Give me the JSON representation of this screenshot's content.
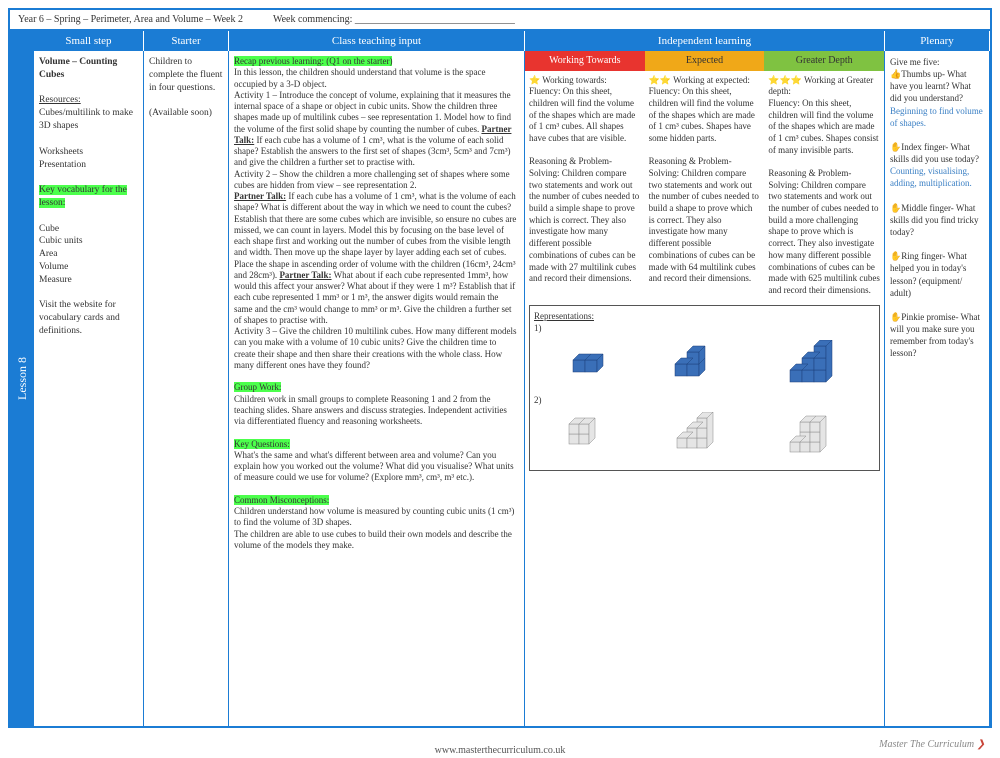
{
  "header": {
    "title": "Year 6 – Spring – Perimeter, Area and Volume – Week 2",
    "week": "Week commencing: ________________________________"
  },
  "lesson_tab": "Lesson 8",
  "col_headers": {
    "c1": "Small step",
    "c2": "Starter",
    "c3": "Class teaching input",
    "c4": "Independent learning",
    "c5": "Plenary"
  },
  "small_step": {
    "title": "Volume – Counting Cubes",
    "res_h": "Resources:",
    "res": "Cubes/multilink to make 3D shapes",
    "ws": "Worksheets",
    "pres": "Presentation",
    "kv_h": "Key vocabulary for the lesson:",
    "kv1": "Cube",
    "kv2": "Cubic units",
    "kv3": "Area",
    "kv4": "Volume",
    "kv5": "Measure",
    "visit": "Visit the website for vocabulary cards and definitions."
  },
  "starter": {
    "t1": "Children to complete the fluent in four questions.",
    "t2": "(Available soon)"
  },
  "teaching": {
    "recap": "Recap previous learning: (Q1 on the starter)",
    "intro": "In this lesson, the children should understand that volume is the space occupied by a 3-D object.",
    "a1": "Activity 1 – Introduce the concept of volume, explaining that it measures the internal space of a shape or object in cubic units. Show the children three shapes made up of multilink cubes – see representation 1. Model how to find the volume of the first solid shape by counting the number of cubes. ",
    "pt1_h": "Partner Talk:",
    "pt1": " If each cube has a volume of 1 cm³, what is the volume of each solid shape? Establish the answers to the first set of shapes (3cm³, 5cm³ and 7cm³) and give the children a further set to practise with.",
    "a2": "Activity 2 – Show the children a more challenging set of shapes where some cubes are hidden from view – see representation 2.",
    "pt2_h": "Partner Talk:",
    "pt2": " If each cube has a volume of 1 cm³, what is the volume of each shape? What is different about the way in which we need to count the cubes? Establish that there are some cubes which are invisible, so ensure no cubes are missed, we can count in layers. Model this by focusing on the base level of each shape first and working out the number of cubes from the visible length and width. Then move up the shape layer by layer adding each set of cubes. Place the shape in ascending order of volume with the children (16cm³, 24cm³ and 28cm³). ",
    "pt3_h": "Partner Talk:",
    "pt3": " What about if each cube represented 1mm³, how would this affect your answer? What about if they were 1 m³? Establish that if each cube represented 1 mm³ or 1 m³, the answer digits would remain the same and the cm³ would change to mm³ or m³. Give the children a further set of shapes to practise with.",
    "a3": "Activity 3 – Give the children 10 multilink cubes. How many different models can you make with a volume of 10 cubic units? Give the children time to create their shape and then share their creations with the whole class. How many different ones have they found?",
    "gw_h": "Group Work:",
    "gw": "Children work in small groups to complete Reasoning 1 and 2 from the teaching slides. Share answers and discuss strategies. Independent activities via differentiated fluency and reasoning worksheets.",
    "kq_h": "Key Questions:",
    "kq": "What's the same and what's different between area and volume? Can you explain how you worked out the volume? What did you visualise? What units of measure could we use for volume? (Explore mm³, cm³, m³ etc.).",
    "cm_h": "Common Misconceptions:",
    "cm": "Children understand how volume is measured by counting cubic units (1 cm³) to find the volume of 3D shapes.\nThe children are able to use cubes to build their own models and describe the volume of the models they make."
  },
  "il": {
    "wt_h": "Working Towards",
    "ex_h": "Expected",
    "gd_h": "Greater Depth",
    "wt": "⭐ Working towards:\nFluency: On this sheet, children will find the volume of the shapes which are made of 1 cm³ cubes. All shapes have cubes that are visible.\n\nReasoning & Problem-Solving: Children compare two statements and work out the number of cubes needed to build a simple shape to prove which is correct. They also investigate how many different possible combinations of cubes can be made with 27 multilink cubes and record their dimensions.",
    "ex": "⭐⭐ Working at expected:\nFluency: On this sheet, children will find the volume of the shapes which are made of 1 cm³ cubes. Shapes have some hidden parts.\n\nReasoning & Problem-Solving: Children compare two statements and work out the number of cubes needed to build a shape to prove which is correct. They also investigate how many different possible combinations of cubes can be made with 64 multilink cubes and record their dimensions.",
    "gd": "⭐⭐⭐ Working at Greater depth:\nFluency: On this sheet, children will find the volume of the shapes which are made of 1 cm³ cubes. Shapes consist of many invisible parts.\n\nReasoning & Problem-Solving: Children compare two statements and work out the number of cubes needed to build a more challenging shape to prove which is correct. They also investigate how many different possible combinations of cubes can be made with 625 multilink cubes and record their dimensions.",
    "reps_h": "Representations:",
    "r1": "1)",
    "r2": "2)"
  },
  "plenary": {
    "intro": "Give me five:",
    "t1": "👍Thumbs up- What have you learnt? What did you understand?",
    "t1a": "Beginning to find volume of shapes.",
    "t2": "✋Index finger- What skills did you use today?",
    "t2a": "Counting, visualising, adding, multiplication.",
    "t3": "✋Middle finger- What skills did you find tricky today?",
    "t4": "✋Ring finger- What helped you in today's lesson? (equipment/ adult)",
    "t5": "✋Pinkie promise- What will you make sure you remember from today's lesson?"
  },
  "footer": "www.masterthecurriculum.co.uk",
  "logo": "Master The Curriculum"
}
